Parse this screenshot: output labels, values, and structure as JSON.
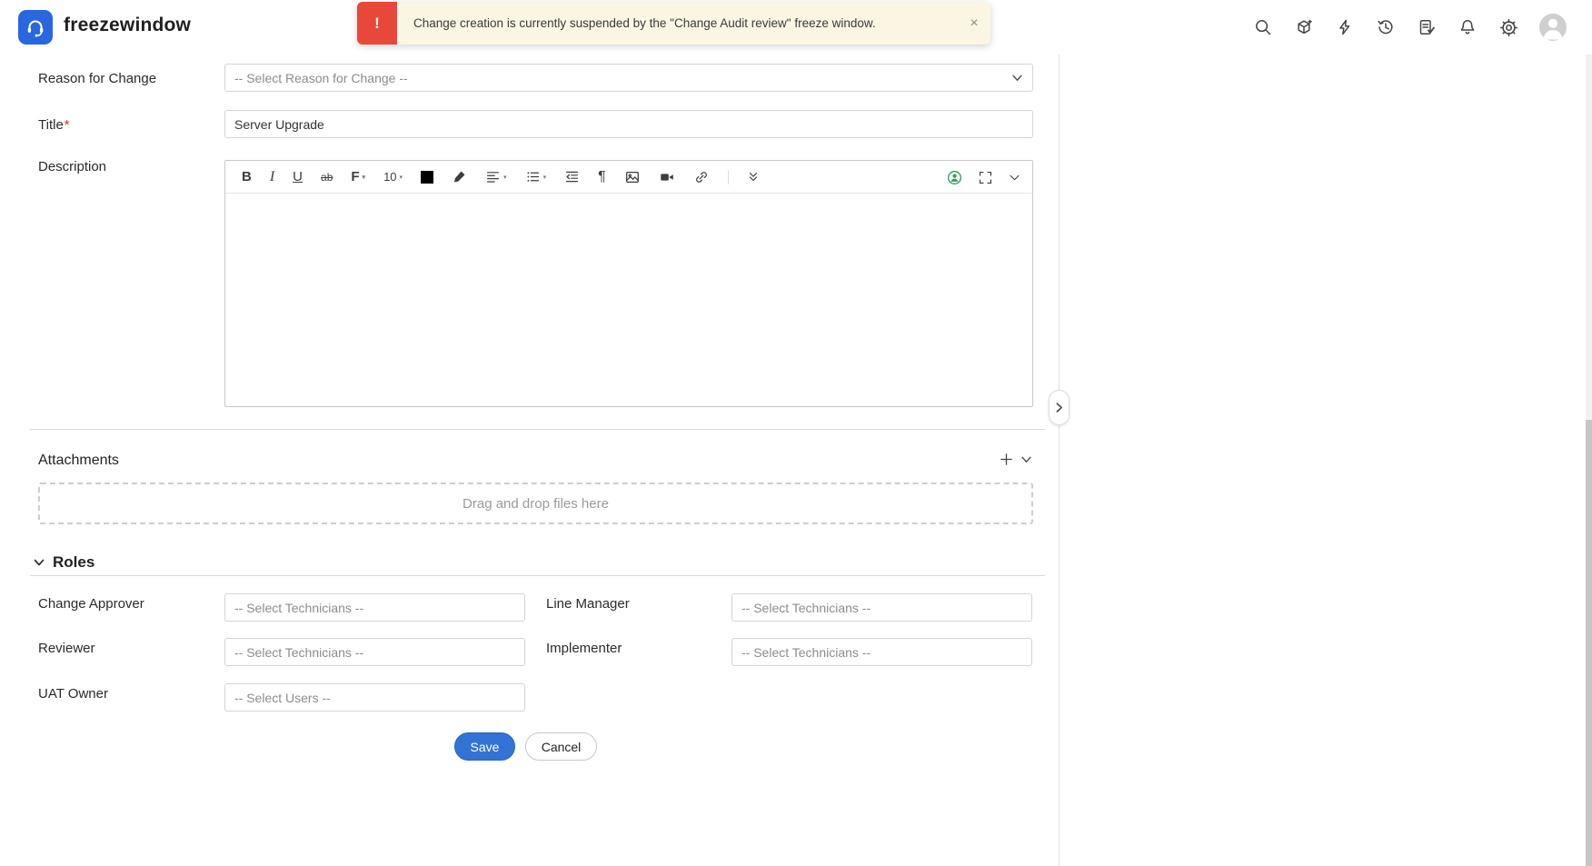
{
  "header": {
    "app_title": "freezewindow",
    "icons": [
      "search",
      "explore",
      "quick-actions",
      "history",
      "approvals",
      "notifications",
      "settings",
      "profile"
    ],
    "alert": {
      "icon_glyph": "!",
      "message": "Change creation is currently suspended by the \"Change Audit review\" freeze window.",
      "close_glyph": "×"
    }
  },
  "form": {
    "reason": {
      "label": "Reason for Change",
      "placeholder": "-- Select Reason for Change --"
    },
    "title": {
      "label": "Title",
      "required_mark": "*",
      "value": "Server Upgrade"
    },
    "description": {
      "label": "Description",
      "toolbar": {
        "bold": "B",
        "italic": "I",
        "underline": "U",
        "strikethrough": "ab",
        "font_family": "F",
        "font_size": "10",
        "icons": [
          "font-color",
          "highlight",
          "align",
          "list",
          "outdent",
          "paragraph",
          "insert-image",
          "insert-video",
          "insert-link",
          "more-formats",
          "insert-user",
          "fullscreen",
          "more-options"
        ]
      }
    },
    "attachments": {
      "title": "Attachments",
      "dropzone_text": "Drag and drop files here"
    },
    "roles": {
      "title": "Roles",
      "fields": [
        {
          "label": "Change Approver",
          "placeholder": "-- Select Technicians --"
        },
        {
          "label": "Line Manager",
          "placeholder": "-- Select Technicians --"
        },
        {
          "label": "Reviewer",
          "placeholder": "-- Select Technicians --"
        },
        {
          "label": "Implementer",
          "placeholder": "-- Select Technicians --"
        },
        {
          "label": "UAT Owner",
          "placeholder": "-- Select Users --"
        }
      ]
    },
    "actions": {
      "save": "Save",
      "cancel": "Cancel"
    }
  },
  "colors": {
    "accent_blue": "#3273d5",
    "alert_bg": "#fbf6e4",
    "alert_red": "#e8483a"
  }
}
